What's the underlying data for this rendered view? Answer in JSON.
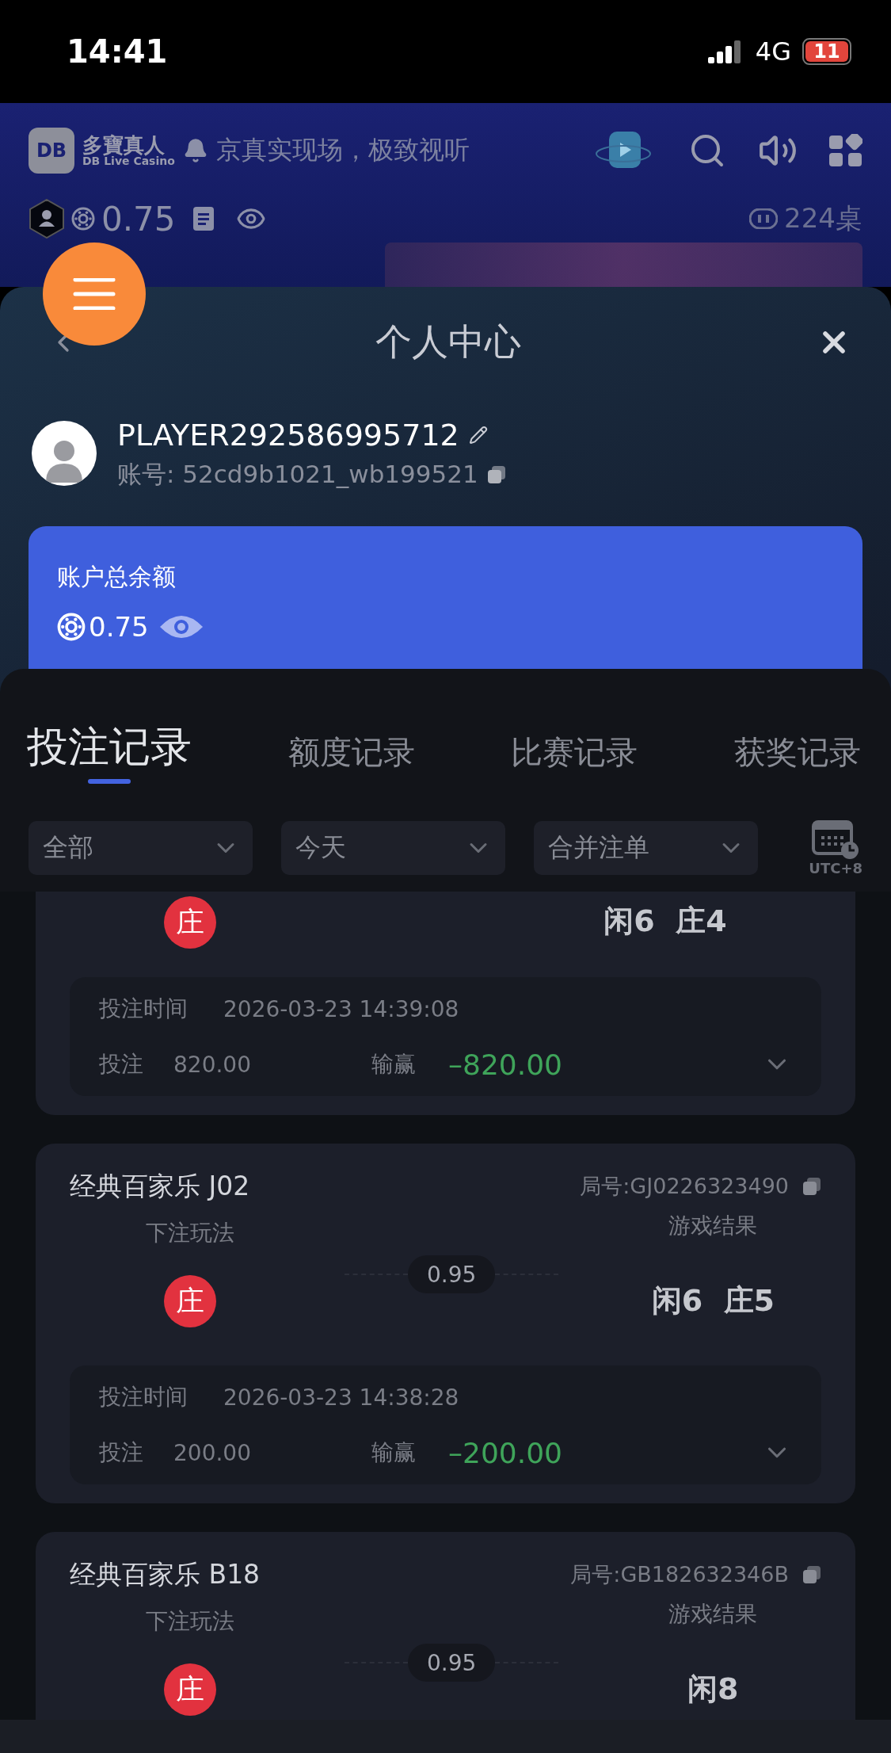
{
  "status_bar": {
    "time": "14:41",
    "network": "4G",
    "battery": "11"
  },
  "header": {
    "logo": "DB",
    "brand_cn": "多寶真人",
    "brand_en": "DB Live Casino",
    "marquee": "京真实现场，极致视听",
    "balance": "0.75",
    "tables": "224桌"
  },
  "panel": {
    "title": "个人中心",
    "username": "PLAYER292586995712",
    "account_label": "账号:",
    "account": "52cd9b1021_wb199521",
    "balance_label": "账户总余额",
    "balance": "0.75"
  },
  "tabs": [
    {
      "label": "投注记录",
      "selected": true
    },
    {
      "label": "额度记录",
      "selected": false
    },
    {
      "label": "比赛记录",
      "selected": false
    },
    {
      "label": "获奖记录",
      "selected": false
    }
  ],
  "filters": [
    "全部",
    "今天",
    "合并注单"
  ],
  "timezone": "UTC+8",
  "bets": [
    {
      "kind": "scrolled",
      "bet": "庄",
      "result": "闲6  庄4",
      "time_label": "投注时间",
      "time": "2026-03-23 14:39:08",
      "stake_label": "投注",
      "stake": "820.00",
      "win_label": "输赢",
      "win": "–820.00"
    },
    {
      "kind": "full",
      "title": "经典百家乐 J02",
      "round": "局号:GJ0226323490",
      "play_label": "下注玩法",
      "result_label": "游戏结果",
      "odds": "0.95",
      "bet": "庄",
      "result": "闲6  庄5",
      "time_label": "投注时间",
      "time": "2026-03-23 14:38:28",
      "stake_label": "投注",
      "stake": "200.00",
      "win_label": "输赢",
      "win": "–200.00"
    },
    {
      "kind": "full",
      "title": "经典百家乐 B18",
      "round": "局号:GB182632346B",
      "play_label": "下注玩法",
      "result_label": "游戏结果",
      "odds": "0.95",
      "bet": "庄",
      "result": "闲8"
    }
  ]
}
